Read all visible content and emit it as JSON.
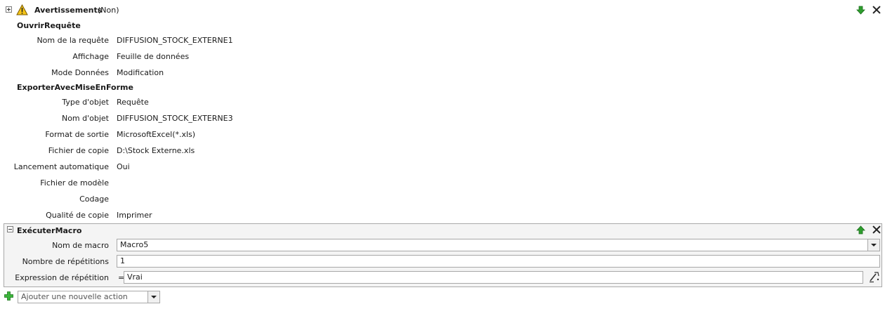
{
  "warnings": {
    "label": "Avertissements",
    "value": "(Non)"
  },
  "open_query": {
    "title": "OuvrirRequête",
    "rows": [
      {
        "label": "Nom de la requête",
        "value": "DIFFUSION_STOCK_EXTERNE1"
      },
      {
        "label": "Affichage",
        "value": "Feuille de données"
      },
      {
        "label": "Mode Données",
        "value": "Modification"
      }
    ]
  },
  "export": {
    "title": "ExporterAvecMiseEnForme",
    "rows": [
      {
        "label": "Type d'objet",
        "value": "Requête"
      },
      {
        "label": "Nom d'objet",
        "value": "DIFFUSION_STOCK_EXTERNE3"
      },
      {
        "label": "Format de sortie",
        "value": "MicrosoftExcel(*.xls)"
      },
      {
        "label": "Fichier de copie",
        "value": "D:\\Stock Externe.xls"
      },
      {
        "label": "Lancement automatique",
        "value": "Oui"
      },
      {
        "label": "Fichier de modèle",
        "value": ""
      },
      {
        "label": "Codage",
        "value": ""
      },
      {
        "label": "Qualité de copie",
        "value": "Imprimer"
      }
    ]
  },
  "run_macro": {
    "title": "ExécuterMacro",
    "macro_name": {
      "label": "Nom de macro",
      "value": "Macro5"
    },
    "repeat_count": {
      "label": "Nombre de répétitions",
      "value": "1"
    },
    "repeat_expression": {
      "label": "Expression de répétition",
      "prefix": "=",
      "value": "Vrai"
    }
  },
  "add_action": {
    "placeholder": "Ajouter une nouvelle action"
  },
  "colors": {
    "green_arrow": "#2e9e2e",
    "block_border": "#a9a9a9",
    "block_bg": "#f4f4f4"
  }
}
